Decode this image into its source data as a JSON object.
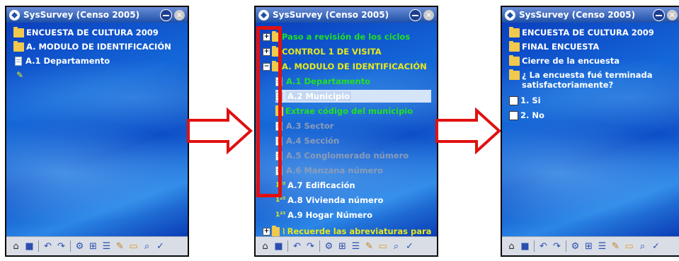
{
  "app_title": "SysSurvey  (Censo 2005)",
  "close_glyph": "✕",
  "colors": {
    "titlebar": "#1d4fa8",
    "background": "#0c4cc6",
    "arrow": "#e01010",
    "green_text": "#22e022",
    "yellow_text": "#e8e81a"
  },
  "panel1": {
    "items": [
      {
        "label": "ENCUESTA DE CULTURA 2009",
        "icon": "open-folder-icon"
      },
      {
        "label": "A. MODULO DE IDENTIFICACIÓN",
        "icon": "folder-icon"
      },
      {
        "label": "A.1 Departamento",
        "icon": "document-icon"
      },
      {
        "label": "",
        "icon": "pencil-icon"
      }
    ]
  },
  "panel2": {
    "items": [
      {
        "label": "Paso a revisión de los ciclos",
        "expander": "+"
      },
      {
        "label": "CONTROL 1 DE VISITA",
        "expander": "+"
      },
      {
        "label": "A. MODULO DE IDENTIFICACIÓN",
        "expander": "−"
      },
      {
        "label": "A.1 Departamento"
      },
      {
        "label": "A.2 Municipio"
      },
      {
        "label": "Extrae código  del municipio"
      },
      {
        "label": "A.3 Sector"
      },
      {
        "label": "A.4 Sección"
      },
      {
        "label": "A.5 Conglomerado número"
      },
      {
        "label": "A.6 Manzana número"
      },
      {
        "label": "A.7 Edificación"
      },
      {
        "label": "A.8 Vivienda número"
      },
      {
        "label": "A.9 Hogar Número"
      },
      {
        "label": "Recuerde las abreviaturas para",
        "expander": "+"
      }
    ]
  },
  "panel3": {
    "items": [
      {
        "label": "ENCUESTA DE CULTURA 2009"
      },
      {
        "label": "FINAL ENCUESTA"
      },
      {
        "label": "Cierre de la encuesta"
      },
      {
        "label": "¿ La encuesta fué terminada"
      },
      {
        "label": "satisfactoriamente?"
      },
      {
        "label": "1. Si"
      },
      {
        "label": "2. No"
      }
    ]
  },
  "toolbar_icons": [
    "home-icon",
    "save-icon",
    "undo-icon",
    "redo-icon",
    "settings-icon",
    "tree-icon",
    "list-icon",
    "edit-icon",
    "open-folder-icon",
    "search-icon",
    "check-icon"
  ],
  "toolbar_glyphs": {
    "home": "⌂",
    "save": "■",
    "undo": "↶",
    "redo": "↷",
    "settings": "⚙",
    "tree": "⊞",
    "list": "☰",
    "edit": "✎",
    "open": "▭",
    "search": "⌕",
    "check": "✓"
  }
}
